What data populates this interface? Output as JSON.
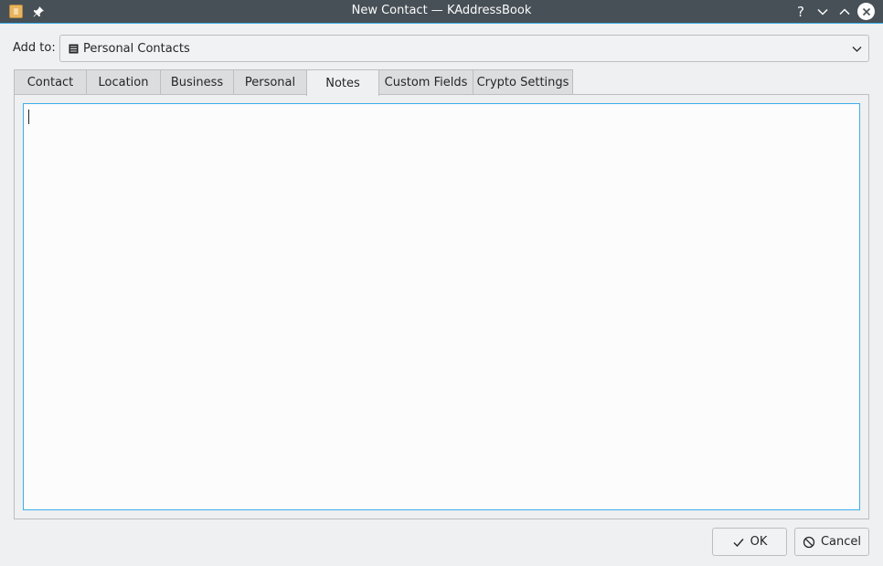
{
  "window": {
    "title": "New Contact — KAddressBook",
    "buttons": {
      "help": "?",
      "help_icon": "help-icon",
      "minimize_icon": "chevron-down-icon",
      "maximize_icon": "chevron-up-icon",
      "close_icon": "close-icon"
    },
    "app_icon": "addressbook-icon",
    "pin_icon": "pin-icon",
    "accent_color": "#3daee9",
    "titlebar_color": "#475057"
  },
  "add_to": {
    "label": "Add to:",
    "selected": "Personal Contacts",
    "icon": "addressbook-list-icon"
  },
  "tabs": [
    {
      "label": "Contact",
      "active": false
    },
    {
      "label": "Location",
      "active": false
    },
    {
      "label": "Business",
      "active": false
    },
    {
      "label": "Personal",
      "active": false
    },
    {
      "label": "Notes",
      "active": true
    },
    {
      "label": "Custom Fields",
      "active": false
    },
    {
      "label": "Crypto Settings",
      "active": false
    }
  ],
  "notes": {
    "value": ""
  },
  "footer": {
    "ok_label": "OK",
    "cancel_label": "Cancel",
    "ok_icon": "checkmark-icon",
    "cancel_icon": "cancel-icon"
  }
}
